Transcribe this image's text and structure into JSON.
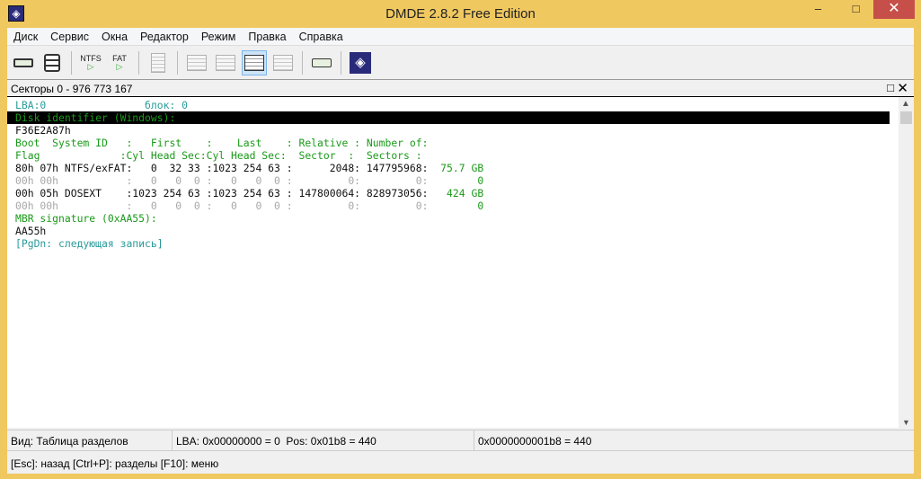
{
  "window": {
    "title": "DMDE 2.8.2 Free Edition",
    "minimize": "–",
    "maximize": "□",
    "close": "✕"
  },
  "menu": [
    "Диск",
    "Сервис",
    "Окна",
    "Редактор",
    "Режим",
    "Правка",
    "Справка"
  ],
  "toolbar": {
    "ntfs": "NTFS",
    "fat": "FAT"
  },
  "pane": {
    "title": "Секторы 0 - 976 773 167",
    "maximize": "□",
    "close": "✕"
  },
  "lines": [
    [
      {
        "t": "LBA:0                блок: 0",
        "c": "teal"
      }
    ],
    [
      {
        "t": "Disk identifier (Windows):",
        "c": "green"
      }
    ],
    [
      {
        "t": "F36E2A87h",
        "c": "black"
      }
    ],
    [
      {
        "t": "Boot  System ID   :   First    :    Last    : Relative : Number of:",
        "c": "green"
      }
    ],
    [
      {
        "t": "Flag             :Cyl Head Sec:Cyl Head Sec:  Sector  :  Sectors :",
        "c": "green"
      }
    ],
    [
      {
        "t": "80h 07h NTFS/exFAT:   0  32 33 :1023 254 63 :      2048: 147795968:",
        "c": "black"
      },
      {
        "t": "  75.7 GB",
        "c": "green"
      }
    ],
    [
      {
        "t": "00h 00h           :   0   0  0 :   0   0  0 :         0:         0:",
        "c": "gray"
      },
      {
        "t": "        0",
        "c": "green"
      }
    ],
    [
      {
        "t": "00h 05h DOSEXT    :1023 254 63 :1023 254 63 : 147800064: 828973056:",
        "c": "black"
      },
      {
        "t": "   424 GB",
        "c": "green"
      }
    ],
    [
      {
        "t": "00h 00h           :   0   0  0 :   0   0  0 :         0:         0:",
        "c": "gray"
      },
      {
        "t": "        0",
        "c": "green"
      }
    ],
    [
      {
        "t": "MBR signature (0xAA55):",
        "c": "green"
      }
    ],
    [
      {
        "t": "AA55h",
        "c": "black"
      }
    ],
    [
      {
        "t": "[PgDn: следующая запись]",
        "c": "teal"
      }
    ]
  ],
  "highlight_line": 1,
  "status": {
    "view": "Вид: Таблица разделов",
    "lba": "LBA: 0x00000000 = 0  Pos: 0x01b8 = 440",
    "offset": "0x0000000001b8 = 440"
  },
  "footer": "[Esc]: назад  [Ctrl+P]: разделы  [F10]: меню"
}
